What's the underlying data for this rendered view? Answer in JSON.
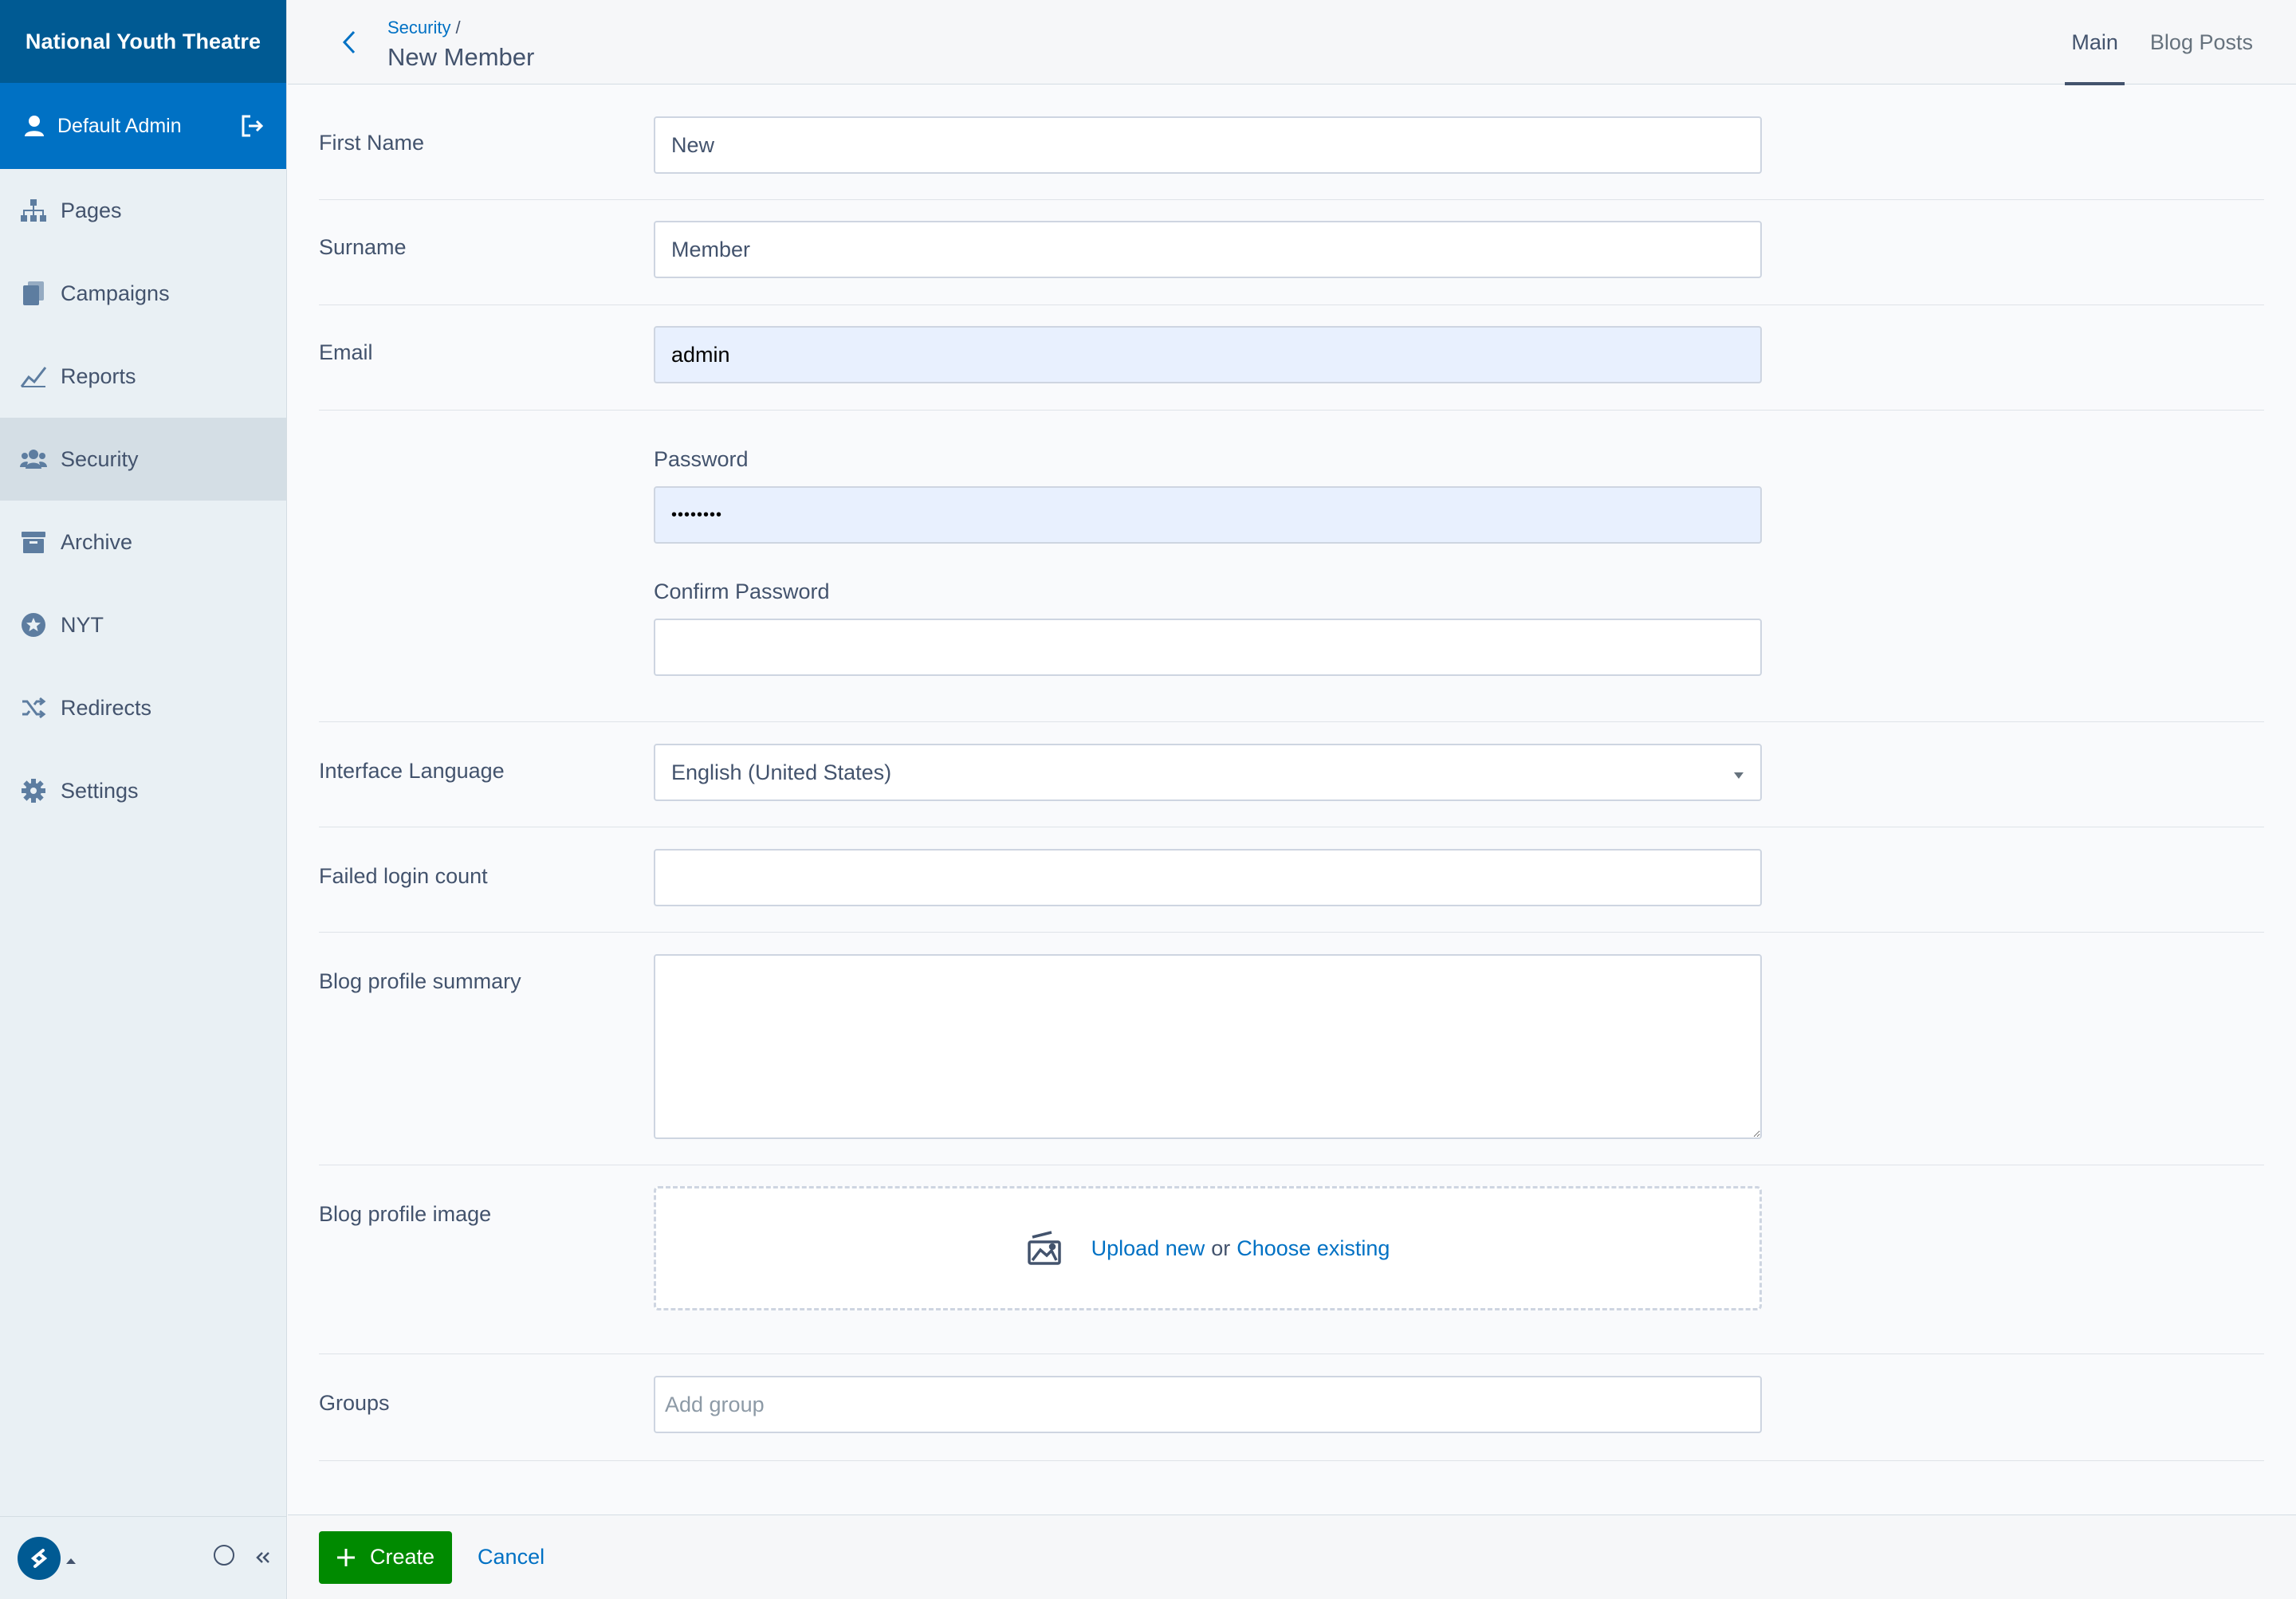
{
  "app": {
    "title": "National Youth Theatre",
    "accent_color": "#005a93",
    "user_bar_color": "#0071c4",
    "create_button_color": "#008a00"
  },
  "user": {
    "name": "Default Admin",
    "logout_icon": "logout-icon"
  },
  "sidebar": {
    "items": [
      {
        "label": "Pages",
        "icon": "sitemap-icon",
        "active": false
      },
      {
        "label": "Campaigns",
        "icon": "documents-icon",
        "active": false
      },
      {
        "label": "Reports",
        "icon": "chart-line-icon",
        "active": false
      },
      {
        "label": "Security",
        "icon": "users-icon",
        "active": true
      },
      {
        "label": "Archive",
        "icon": "archive-box-icon",
        "active": false
      },
      {
        "label": "NYT",
        "icon": "star-circle-icon",
        "active": false
      },
      {
        "label": "Redirects",
        "icon": "shuffle-icon",
        "active": false
      },
      {
        "label": "Settings",
        "icon": "gear-icon",
        "active": false
      }
    ]
  },
  "header": {
    "breadcrumb": "Security",
    "breadcrumb_separator": "/",
    "title": "New Member",
    "tabs": [
      {
        "label": "Main",
        "active": true
      },
      {
        "label": "Blog Posts",
        "active": false
      }
    ]
  },
  "form": {
    "first_name": {
      "label": "First Name",
      "value": "New"
    },
    "surname": {
      "label": "Surname",
      "value": "Member"
    },
    "email": {
      "label": "Email",
      "value": "admin"
    },
    "password": {
      "label": "Password",
      "value": "••••••••"
    },
    "confirm_password": {
      "label": "Confirm Password",
      "value": ""
    },
    "interface_language": {
      "label": "Interface Language",
      "value": "English (United States)"
    },
    "failed_login_count": {
      "label": "Failed login count",
      "value": ""
    },
    "blog_profile_summary": {
      "label": "Blog profile summary",
      "value": ""
    },
    "blog_profile_image": {
      "label": "Blog profile image",
      "upload_new": "Upload new",
      "or": "or",
      "choose_existing": "Choose existing"
    },
    "groups": {
      "label": "Groups",
      "placeholder": "Add group"
    }
  },
  "actions": {
    "create_label": "Create",
    "cancel_label": "Cancel"
  }
}
